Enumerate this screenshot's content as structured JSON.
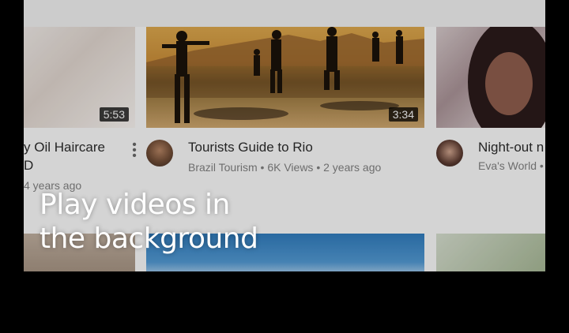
{
  "videos": [
    {
      "title": "y Oil Haircare",
      "title2": "D",
      "meta": "4 years ago",
      "duration": "5:53"
    },
    {
      "title": "Tourists Guide to Rio",
      "channel": "Brazil Tourism",
      "views": "6K Views",
      "age": "2 years ago",
      "meta": "Brazil Tourism • 6K Views • 2 years ago",
      "duration": "3:34"
    },
    {
      "title": "Night-out n",
      "meta": "Eva's World •"
    }
  ],
  "caption": {
    "line1": "Play videos in",
    "line2": "the background"
  },
  "icons": {
    "more": "kebab-menu-icon"
  }
}
